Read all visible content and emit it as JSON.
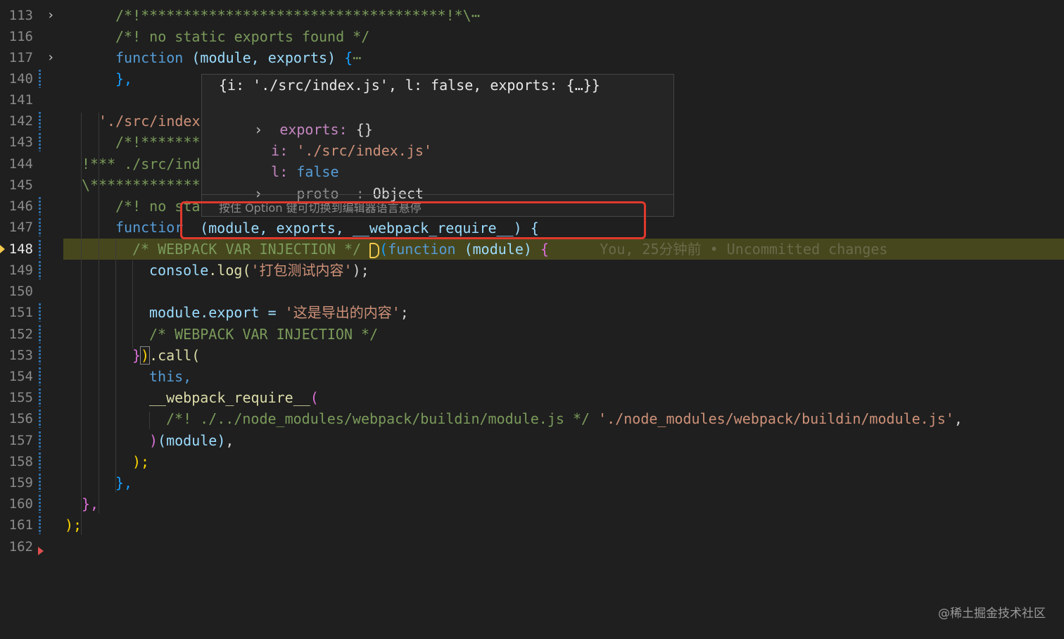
{
  "editor": {
    "line_numbers": [
      "113",
      "116",
      "117",
      "140",
      "141",
      "142",
      "143",
      "144",
      "145",
      "146",
      "147",
      "148",
      "149",
      "150",
      "151",
      "152",
      "153",
      "154",
      "155",
      "156",
      "157",
      "158",
      "159",
      "160",
      "161",
      "162"
    ],
    "lines": {
      "l113": "/*!************************************!*\\",
      "l113_ellipsis": "⋯",
      "l116": "/*! no static exports found */",
      "l117_kw": "function",
      "l117_args": "(module, exports)",
      "l117_brace": " {",
      "l117_ellipsis": "⋯",
      "l140": "},",
      "l142": "'./src/index",
      "l143": "/*!*******",
      "l144": "!*** ./src/ind",
      "l145": "\\*************",
      "l146": "/*! no sta",
      "l147_kw": "functior",
      "l148_comment": "/* WEBPACK VAR INJECTION */",
      "l148_kw": "function",
      "l148_args": "(module)",
      "l148_brace": " {",
      "l148_blame": "You, 25分钟前 • Uncommitted changes",
      "l149_a": "console",
      "l149_b": ".log(",
      "l149_str": "'打包测试内容'",
      "l149_c": ");",
      "l151_a": "module",
      "l151_b": ".export = ",
      "l151_str": "'这是导出的内容'",
      "l151_c": ";",
      "l152": "/* WEBPACK VAR INJECTION */",
      "l153_a": "}",
      "l153_b": ")",
      "l153_c": ".call(",
      "l154": "this,",
      "l155": "__webpack_require__",
      "l155_paren": "(",
      "l156_comment": "/*! ./../node_modules/webpack/buildin/module.js */",
      "l156_str": "'./node_modules/webpack/buildin/module.js'",
      "l156_end": ",",
      "l157_a": ")",
      "l157_b": "(module)",
      "l157_c": ",",
      "l158": ");",
      "l159": "},",
      "l160": "},",
      "l161": ");"
    }
  },
  "hover": {
    "header": "{i: './src/index.js', l: false, exports: {…}}",
    "items": [
      {
        "key": "exports",
        "sep": ": ",
        "value": "{}"
      },
      {
        "key": "i",
        "sep": ": ",
        "value": "'./src/index.js'"
      },
      {
        "key": "l",
        "sep": ": ",
        "value": "false"
      },
      {
        "key": "__proto__",
        "sep": ": ",
        "value": "Object"
      }
    ],
    "hint": "按住 Option 键可切换到编辑器语言悬停",
    "signature": "(module, exports, __webpack_require__) {"
  },
  "watermark": "@稀土掘金技术社区",
  "colors": {
    "background": "#1f1f1f",
    "current_line": "#47471e",
    "highlight_box": "#e0392d",
    "keyword": "#569cd6",
    "string": "#ce9178",
    "comment": "#7a9a5a"
  }
}
